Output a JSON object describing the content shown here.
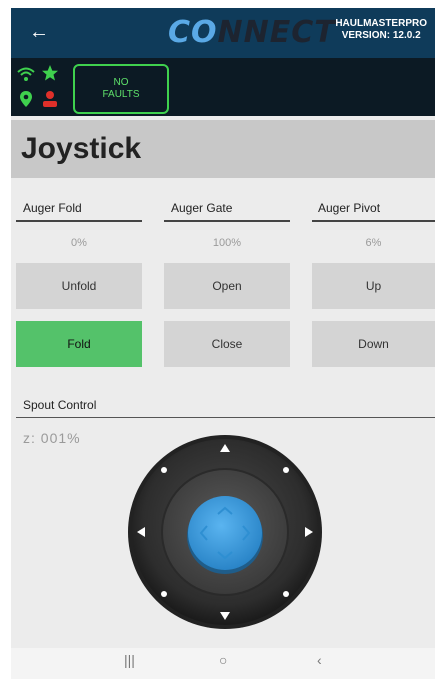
{
  "header": {
    "back_icon": "arrow-left-icon",
    "logo_prefix": "CO",
    "logo_rest": "NNECT",
    "brand_line1": "HAULMASTERPRO",
    "brand_line2": "VERSION: 12.0.2",
    "bg_color": "#0f3b5a"
  },
  "status": {
    "icons": [
      "wifi-icon",
      "star-icon",
      "location-pin-icon",
      "person-icon"
    ],
    "faults_line1": "NO",
    "faults_line2": "FAULTS",
    "ok_color": "#3fd14e",
    "alert_color": "#e0302a"
  },
  "page": {
    "title": "Joystick"
  },
  "controls": [
    {
      "label": "Auger Fold",
      "percent": "0%",
      "up_label": "Unfold",
      "down_label": "Fold",
      "active": "down"
    },
    {
      "label": "Auger Gate",
      "percent": "100%",
      "up_label": "Open",
      "down_label": "Close",
      "active": "none"
    },
    {
      "label": "Auger Pivot",
      "percent": "6%",
      "up_label": "Up",
      "down_label": "Down",
      "active": "none"
    }
  ],
  "spout": {
    "label": "Spout Control",
    "z_readout": "z: 001%",
    "knob_color": "#3d9ee0"
  },
  "nav": {
    "recents": "|||",
    "home": "○",
    "back": "‹"
  }
}
